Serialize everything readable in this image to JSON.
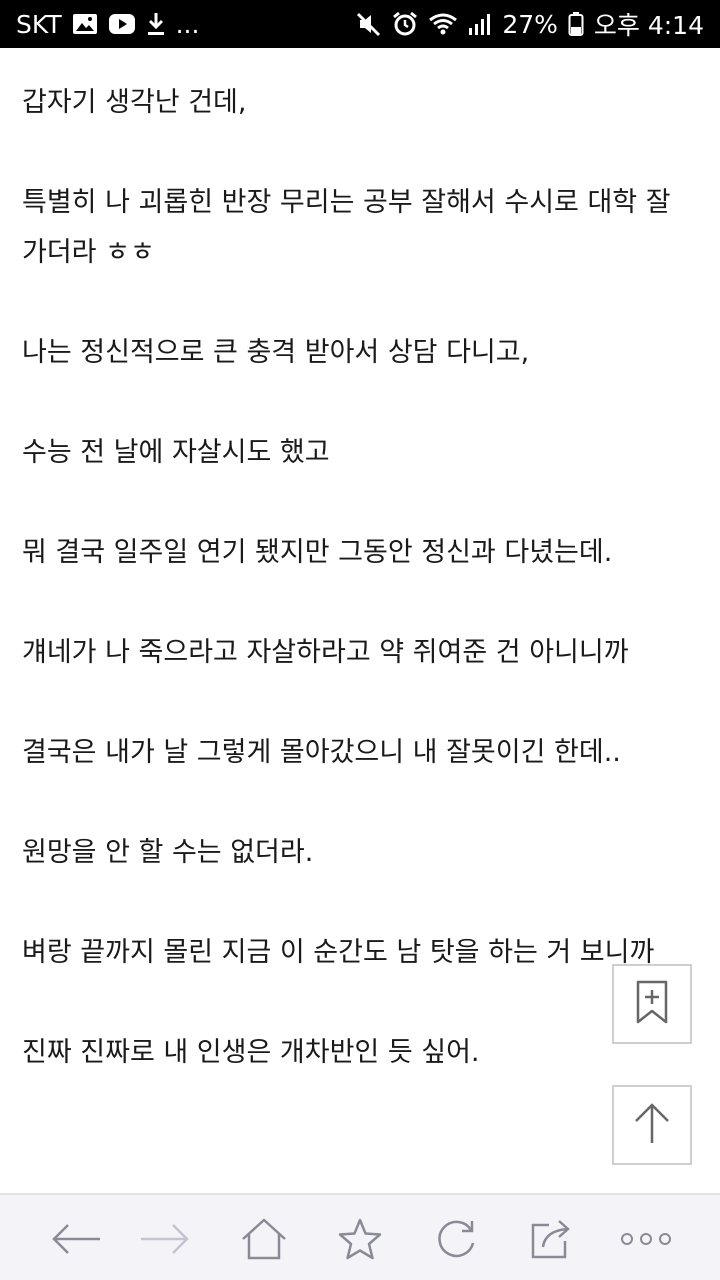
{
  "status_bar": {
    "carrier": "SKT",
    "more": "...",
    "battery_percent": "27%",
    "time": "오후 4:14"
  },
  "article": {
    "paragraphs": [
      "갑자기 생각난 건데,",
      "특별히 나 괴롭힌 반장 무리는 공부 잘해서 수시로 대학 잘 가더라 ㅎㅎ",
      "나는 정신적으로 큰 충격 받아서 상담 다니고,",
      "수능 전 날에 자살시도 했고",
      "뭐 결국 일주일 연기 됐지만 그동안 정신과 다녔는데.",
      "걔네가 나 죽으라고 자살하라고 약 쥐여준 건 아니니까",
      "결국은 내가 날 그렇게 몰아갔으니 내 잘못이긴 한데..",
      "원망을 안 할 수는 없더라.",
      "벼랑 끝까지 몰린 지금 이 순간도 남 탓을 하는 거 보니까",
      "진짜 진짜로 내 인생은 개차반인 듯 싶어."
    ]
  },
  "icons": {
    "status_left": [
      "gallery-icon",
      "youtube-icon",
      "download-icon"
    ],
    "status_right": [
      "mute-icon",
      "alarm-icon",
      "wifi-icon",
      "signal-icon",
      "battery-icon"
    ],
    "floating": [
      "bookmark-add-icon",
      "arrow-up-icon"
    ],
    "bottom_nav": [
      "back-arrow-icon",
      "forward-arrow-icon",
      "home-icon",
      "star-icon",
      "refresh-icon",
      "share-icon",
      "more-icon"
    ]
  },
  "colors": {
    "status_bar_bg": "#000000",
    "text": "#1a1a1a",
    "nav_icon": "#8a8a96",
    "nav_icon_disabled": "#c4c4d0",
    "bottom_bar_bg": "#f4f4f8"
  }
}
